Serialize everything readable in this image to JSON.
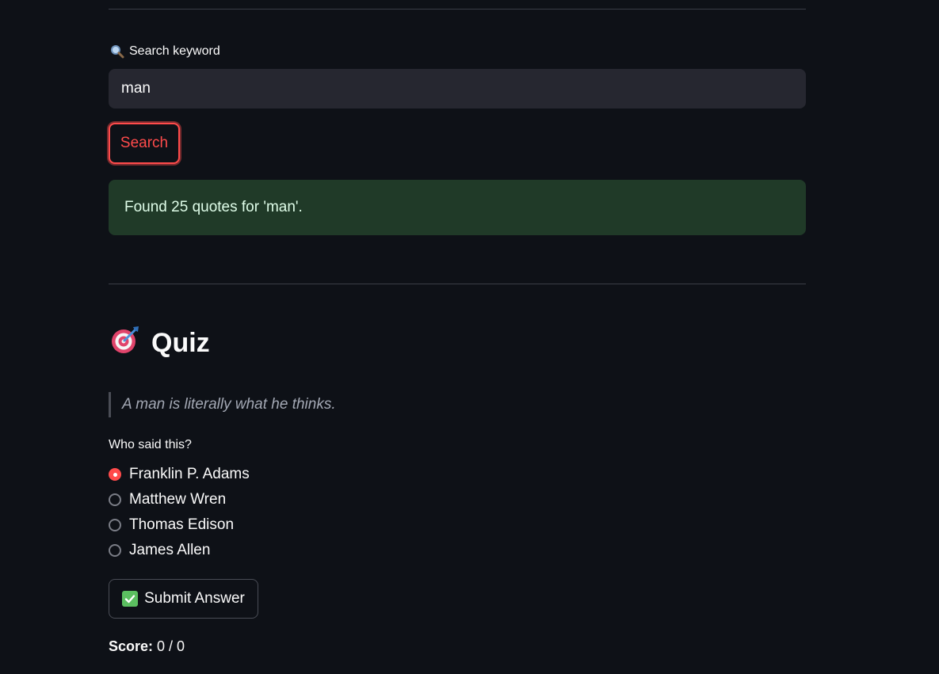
{
  "search": {
    "label": "Search keyword",
    "label_icon": "magnifier-icon",
    "value": "man",
    "button_label": "Search"
  },
  "result": {
    "message": "Found 25 quotes for 'man'."
  },
  "quiz": {
    "title": "Quiz",
    "title_icon": "target-icon",
    "quote": "A man is literally what he thinks.",
    "question": "Who said this?",
    "options": [
      {
        "label": "Franklin P. Adams",
        "selected": true
      },
      {
        "label": "Matthew Wren",
        "selected": false
      },
      {
        "label": "Thomas Edison",
        "selected": false
      },
      {
        "label": "James Allen",
        "selected": false
      }
    ],
    "submit_label": "Submit Answer",
    "submit_icon": "check-mark-icon",
    "score_label": "Score:",
    "score_value": "0 / 0"
  },
  "colors": {
    "background": "#0e1117",
    "accent": "#ff4b4b",
    "success_bg": "#203a28",
    "input_bg": "#262730"
  }
}
